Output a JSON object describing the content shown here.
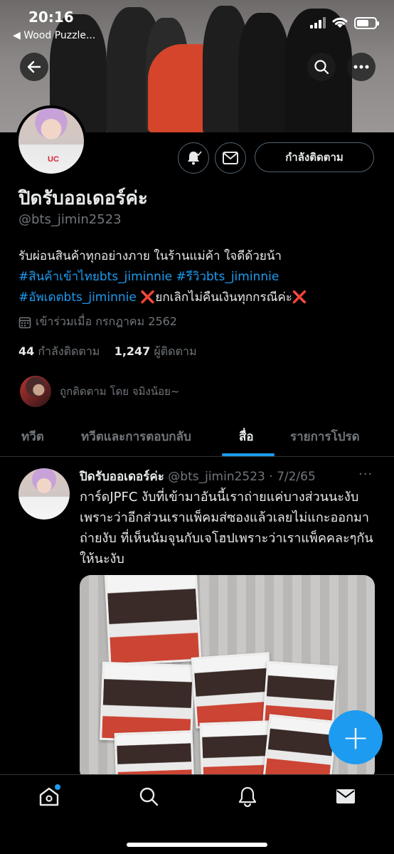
{
  "status_bar": {
    "time": "20:16",
    "back_app": "◀ Wood Puzzle..."
  },
  "profile": {
    "display_name": "ปิดรับออเดอร์ค่ะ",
    "handle": "@bts_jimin2523",
    "bio_line1": "รับผ่อนสินค้าทุกอย่างภาย ในร้านแม่ค้า ใจดีด้วยน้า",
    "bio_tag1": "#สินค้าเข้าไทยbts_jiminnie",
    "bio_tag2": "#รีวิวbts_jiminnie",
    "bio_tag3": "#อัพเดตbts_jiminnie",
    "bio_x1": "❌",
    "bio_notice": "ยกเลิกไม่คืนเงินทุกกรณีค่ะ",
    "bio_x2": "❌",
    "joined": "เข้าร่วมเมื่อ กรกฎาคม 2562",
    "following_count": "44",
    "following_label": "กำลังติดตาม",
    "followers_count": "1,247",
    "followers_label": "ผู้ติดตาม",
    "followed_by": "ถูกติดตาม โดย จมิงน้อย~",
    "follow_button": "กำลังติดตาม"
  },
  "tabs": [
    {
      "label": "ทวีต"
    },
    {
      "label": "ทวีตและการตอบกลับ"
    },
    {
      "label": "สื่อ",
      "active": true
    },
    {
      "label": "รายการโปรด"
    }
  ],
  "tweet": {
    "name": "ปิดรับออเดอร์ค่ะ",
    "meta": "@bts_jimin2523 · 7/2/65",
    "more": "···",
    "text": "การ์ดJPFC งับที่เข้ามาอันนี้เราถ่ายแค่บางส่วนนะงับเพราะว่าอีกส่วนเราแพ็คมส่ซองแล้วเลยไม่แกะออกมาถ่ายงับ ที่เห็นนัมจุนกับเจโฮปเพราะว่าเราแพ็คคละๆกัน ให้นะงับ"
  },
  "fab": {
    "label": "+"
  },
  "colors": {
    "accent": "#1d9bf0",
    "background": "#000000",
    "secondary_text": "#71767b",
    "cross": "#e02b2b"
  },
  "icons": [
    "back-arrow-icon",
    "search-icon",
    "more-icon",
    "bell-icon",
    "mail-icon",
    "calendar-icon",
    "home-icon",
    "search-nav-icon",
    "notifications-icon",
    "messages-icon"
  ]
}
